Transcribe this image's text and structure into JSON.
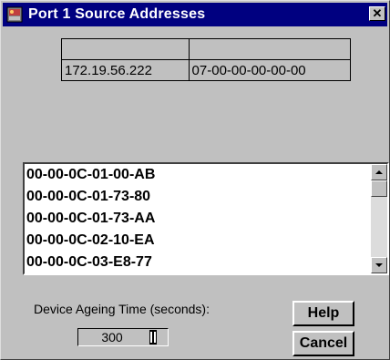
{
  "window": {
    "title": "Port 1 Source Addresses",
    "close_glyph": "✕"
  },
  "address_table": {
    "header": [
      "",
      ""
    ],
    "rows": [
      [
        "172.19.56.222",
        "07-00-00-00-00-00"
      ]
    ]
  },
  "mac_list": {
    "items": [
      "00-00-0C-01-00-AB",
      "00-00-0C-01-73-80",
      "00-00-0C-01-73-AA",
      "00-00-0C-02-10-EA",
      "00-00-0C-03-E8-77"
    ]
  },
  "ageing": {
    "label": "Device Ageing Time (seconds):",
    "value": "300"
  },
  "buttons": {
    "help": "Help",
    "cancel": "Cancel"
  },
  "icons": {
    "app": "app-icon",
    "close": "close-icon",
    "scroll_up": "scroll-up-icon",
    "scroll_down": "scroll-down-icon",
    "cursor": "ibeam-cursor-icon"
  },
  "colors": {
    "titlebar": "#000080",
    "face": "#c0c0c0",
    "list_bg": "#ffffff"
  }
}
